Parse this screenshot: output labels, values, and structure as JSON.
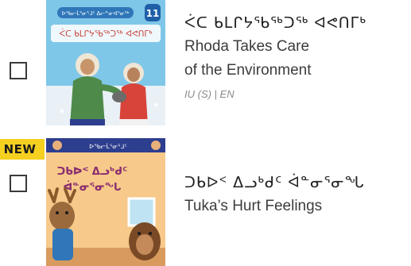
{
  "books": [
    {
      "checked": false,
      "badge": "",
      "cover_top_banner": "ᐅᖃᓕᒫᕐᓂᕐᒧᑦ ᐃᓕᓐᓂᐊᕐᓂᖅ",
      "cover_number": "11",
      "cover_title": "ᐹᑕ ᑲᒪᒋᔭᖃᖅᑐᖅ ᐊᕙᑎᒥᒃ",
      "title_syllabics": "ᐹᑕ ᑲᒪᒋᔭᖃᖅᑐᖅ ᐊᕙᑎᒥᒃ",
      "title_english_line1": "Rhoda Takes Care",
      "title_english_line2": "of the Environment",
      "language": "IU (S) | EN",
      "cover_colors": {
        "sky": "#7fc7e8",
        "ground": "#e9f1f6",
        "banner": "#2f77b8",
        "number_badge": "#1f5fa8"
      }
    },
    {
      "checked": false,
      "badge": "NEW",
      "cover_top_banner": "ᐅᖃᓕᒫᕐᓂᕐᒧᑦ",
      "cover_title_line1": "ᑐᑲᐅᑉ ᐃᓗᒃᑯᑦ",
      "cover_title_line2": "ᐋᓐᓂᕐᓂᖓ",
      "title_syllabics": "ᑐᑲᐅᑉ ᐃᓗᒃᑯᑦ ᐋᓐᓂᕐᓂᖓ",
      "title_english": "Tuka’s Hurt Feelings",
      "cover_colors": {
        "wall": "#f7c98a",
        "title_text": "#8a2d6f",
        "banner": "#2d3e8f"
      }
    }
  ]
}
